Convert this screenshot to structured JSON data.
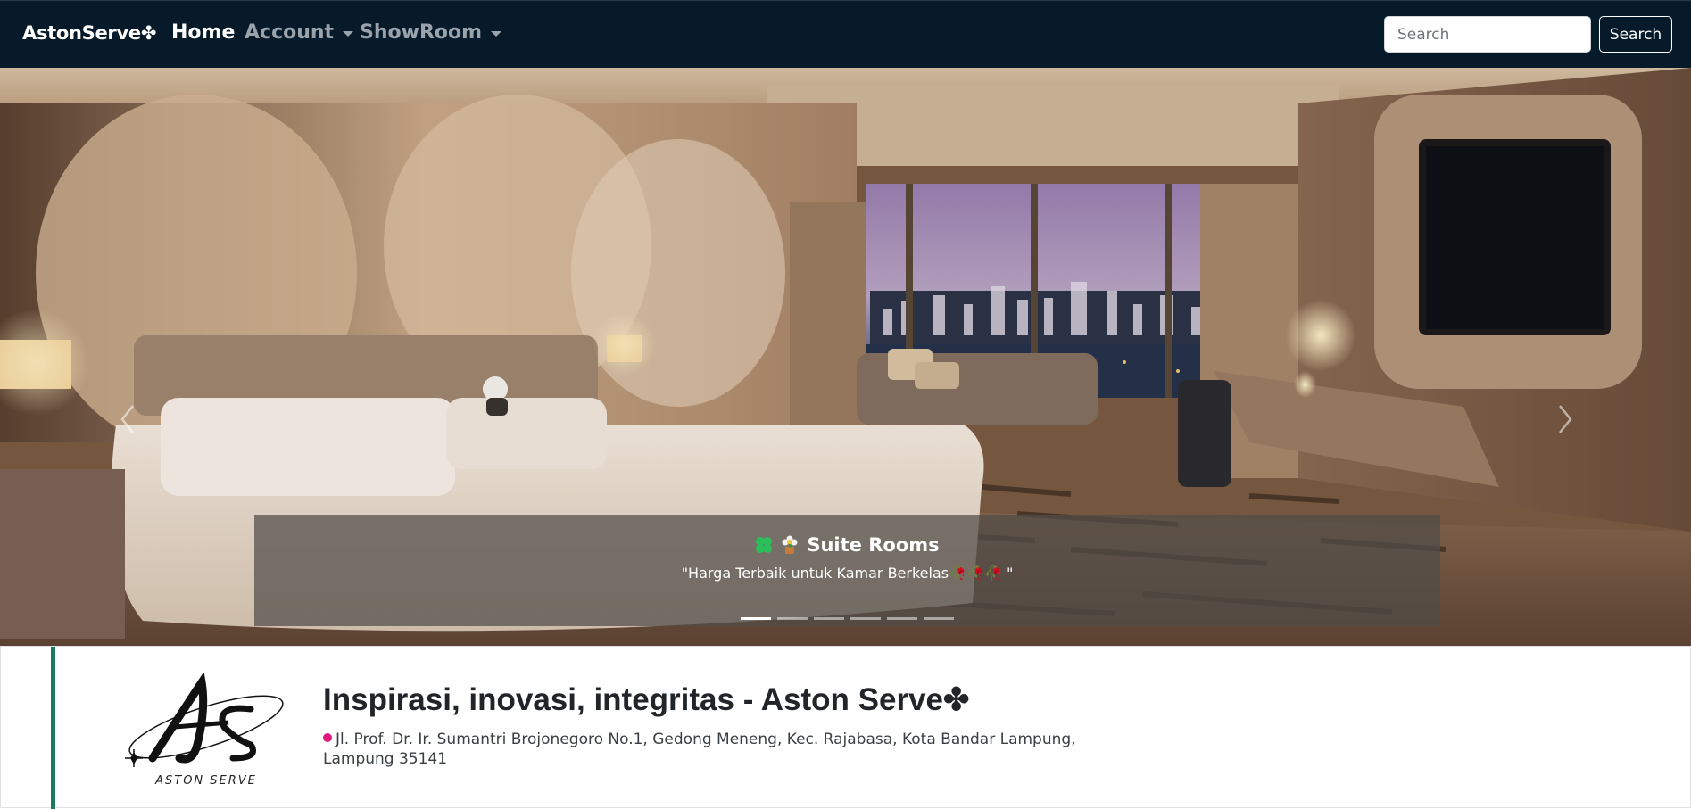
{
  "navbar": {
    "brand": "AstonServe✤",
    "links": [
      {
        "label": "Home",
        "active": true
      },
      {
        "label": "Account",
        "dropdown": true
      },
      {
        "label": "ShowRoom",
        "dropdown": true
      }
    ],
    "search_placeholder": "Search",
    "search_button": "Search"
  },
  "hero": {
    "caption_title": "Suite Rooms",
    "caption_subtitle": "\"Harga Terbaik untuk Kamar Berkelas🥀🥀🥀 \"",
    "slide_count": 6,
    "active_slide": 1,
    "icons": [
      "four-leaf-clover-icon",
      "potted-flower-icon"
    ]
  },
  "info": {
    "title": "Inspirasi, inovasi, integritas - Aston Serve✤",
    "address": "Jl. Prof. Dr. Ir. Sumantri Brojonegoro No.1, Gedong Meneng, Kec. Rajabasa, Kota Bandar Lampung, Lampung 35141",
    "logo_text": "ASTON SERVE",
    "accent_color": "#1c7a5e"
  },
  "colors": {
    "navbar_bg": "#071a2a",
    "nav_inactive": "#9aa3ab"
  }
}
